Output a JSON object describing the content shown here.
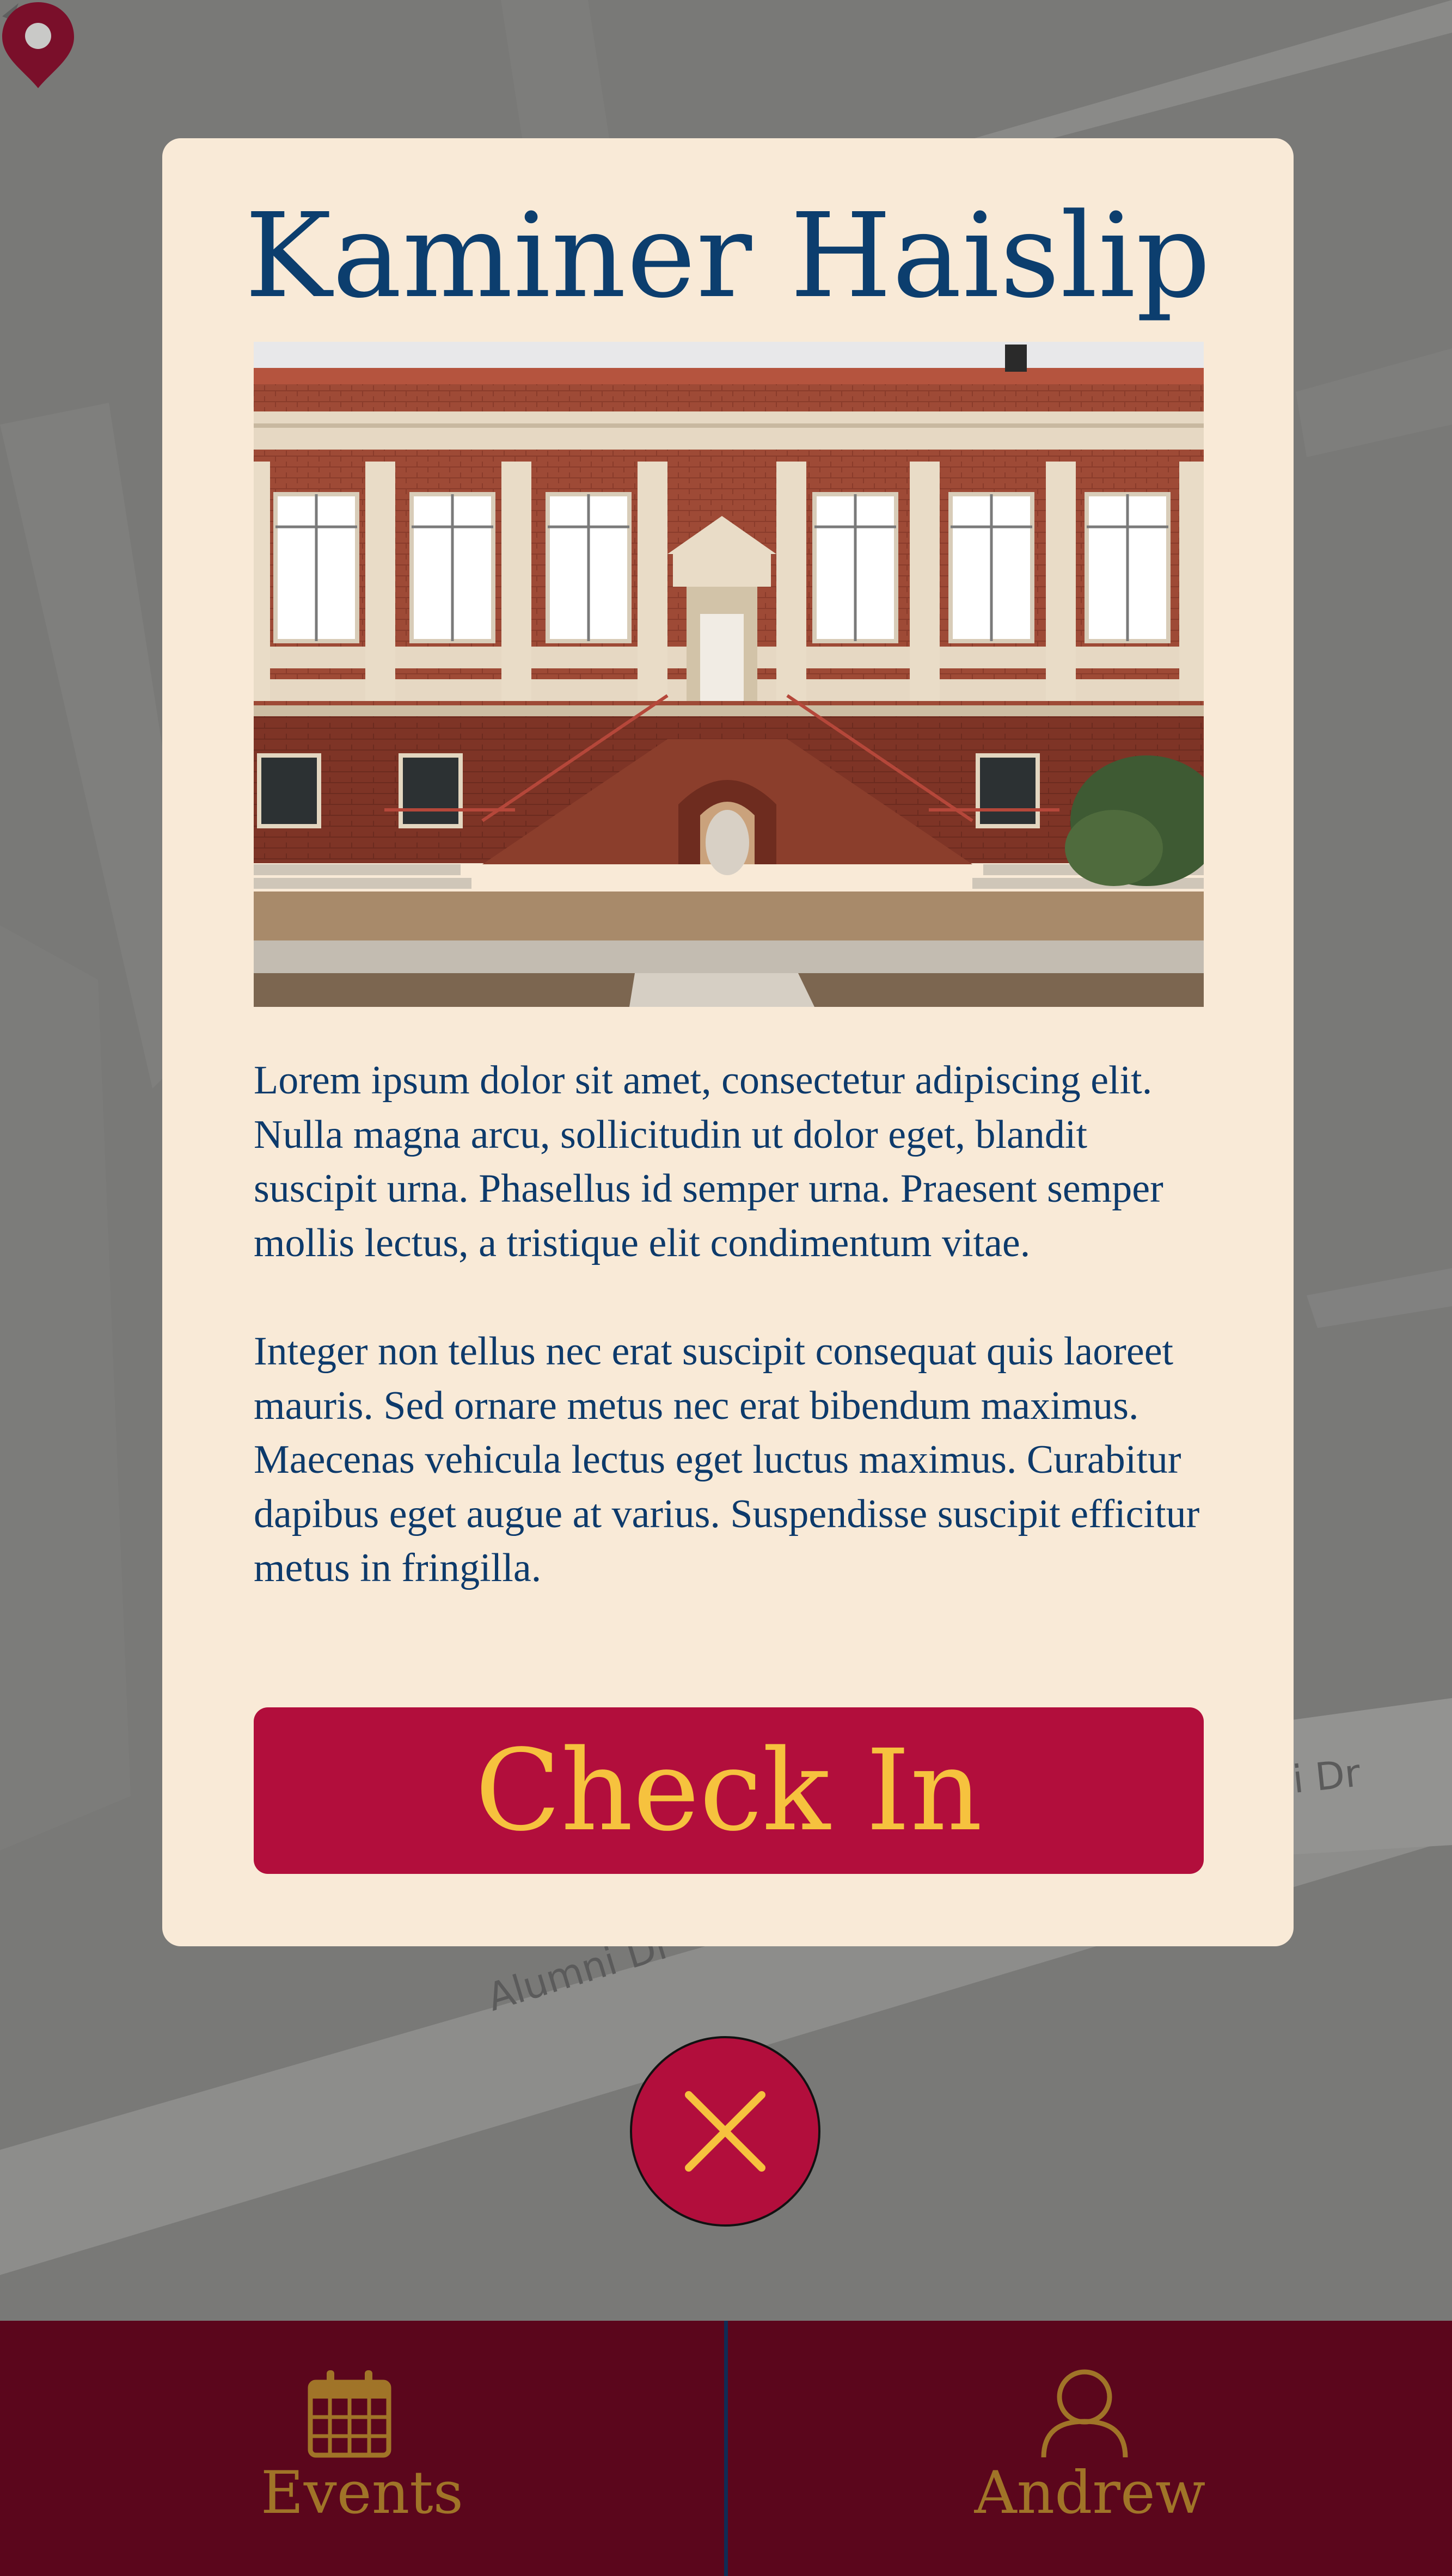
{
  "map": {
    "road_labels": [
      "ni Dr",
      "Alumni Dr"
    ],
    "marker_color": "#7a0f2a"
  },
  "modal": {
    "title": "Kaminer Haislip",
    "photo_alt": "Kaminer Haislip building",
    "description": [
      "Lorem ipsum dolor sit amet, consectetur adipiscing elit. Nulla magna arcu, sollicitudin ut dolor eget, blandit suscipit urna. Phasellus id semper urna. Praesent semper mollis lectus, a tristique elit condi­mentum vitae.",
      "Integer non tellus nec erat suscipit consequat quis laoreet mauris. Sed ornare metus nec erat bibendum maximus. Maecenas vehicula lectus eget luctus maximus. Curabitur dapibus eget augue at varius. Suspendisse suscipit efficitur metus in fringilla."
    ],
    "check_in_label": "Check In",
    "close_icon": "close-icon"
  },
  "tabbar": {
    "tabs": [
      {
        "label": "Events",
        "icon": "calendar-icon"
      },
      {
        "label": "Andrew",
        "icon": "person-icon"
      }
    ]
  },
  "colors": {
    "brand_crimson": "#b20e3c",
    "brand_gold": "#f6c23e",
    "navy_text": "#0c3e6e",
    "card_bg": "#f9ead7",
    "tabbar_bg": "#5b061c",
    "tab_text": "#a07428"
  }
}
